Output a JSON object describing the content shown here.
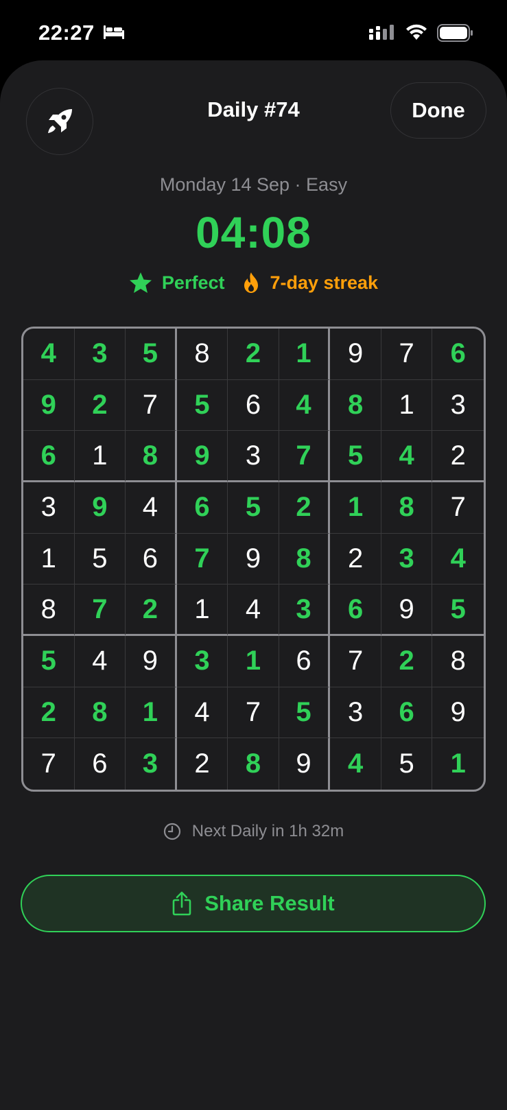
{
  "status_bar": {
    "time": "22:27",
    "icons": [
      "bed-icon",
      "cellular-signal-icon",
      "wifi-icon",
      "battery-icon"
    ]
  },
  "header": {
    "left_button_icon": "rocket-icon",
    "title": "Daily #74",
    "done_label": "Done"
  },
  "summary": {
    "subtitle": "Monday 14 Sep · Easy",
    "time": "04:08",
    "badges": {
      "perfect": {
        "label": "Perfect",
        "icon": "star-icon"
      },
      "streak": {
        "label": "7-day streak",
        "icon": "flame-icon"
      }
    }
  },
  "sudoku": {
    "rows": [
      [
        "4",
        "3",
        "5",
        "8",
        "2",
        "1",
        "9",
        "7",
        "6"
      ],
      [
        "9",
        "2",
        "7",
        "5",
        "6",
        "4",
        "8",
        "1",
        "3"
      ],
      [
        "6",
        "1",
        "8",
        "9",
        "3",
        "7",
        "5",
        "4",
        "2"
      ],
      [
        "3",
        "9",
        "4",
        "6",
        "5",
        "2",
        "1",
        "8",
        "7"
      ],
      [
        "1",
        "5",
        "6",
        "7",
        "9",
        "8",
        "2",
        "3",
        "4"
      ],
      [
        "8",
        "7",
        "2",
        "1",
        "4",
        "3",
        "6",
        "9",
        "5"
      ],
      [
        "5",
        "4",
        "9",
        "3",
        "1",
        "6",
        "7",
        "2",
        "8"
      ],
      [
        "2",
        "8",
        "1",
        "4",
        "7",
        "5",
        "3",
        "6",
        "9"
      ],
      [
        "7",
        "6",
        "3",
        "2",
        "8",
        "9",
        "4",
        "5",
        "1"
      ]
    ],
    "solved_mask": [
      [
        1,
        1,
        1,
        0,
        1,
        1,
        0,
        0,
        1
      ],
      [
        1,
        1,
        0,
        1,
        0,
        1,
        1,
        0,
        0
      ],
      [
        1,
        0,
        1,
        1,
        0,
        1,
        1,
        1,
        0
      ],
      [
        0,
        1,
        0,
        1,
        1,
        1,
        1,
        1,
        0
      ],
      [
        0,
        0,
        0,
        1,
        0,
        1,
        0,
        1,
        1
      ],
      [
        0,
        1,
        1,
        0,
        0,
        1,
        1,
        0,
        1
      ],
      [
        1,
        0,
        0,
        1,
        1,
        0,
        0,
        1,
        0
      ],
      [
        1,
        1,
        1,
        0,
        0,
        1,
        0,
        1,
        0
      ],
      [
        0,
        0,
        1,
        0,
        1,
        0,
        1,
        0,
        1
      ]
    ]
  },
  "footer": {
    "next_daily": "Next Daily in 1h 32m",
    "share_label": "Share Result"
  },
  "colors": {
    "accent_green": "#30d158",
    "accent_orange": "#ff9f0a",
    "sheet_bg": "#1c1c1e",
    "secondary_text": "#8e8e93"
  }
}
